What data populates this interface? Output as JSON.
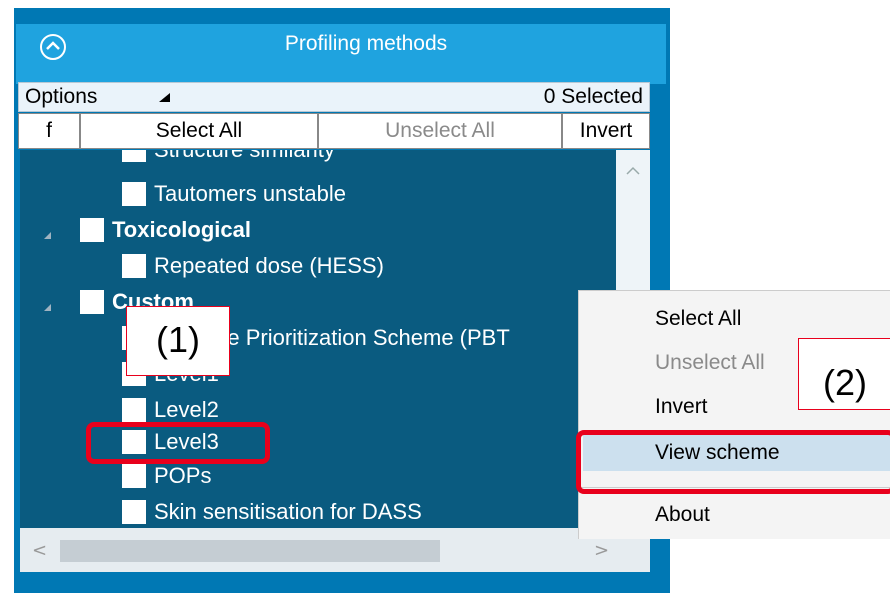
{
  "panel": {
    "title": "Profiling methods",
    "options_label": "Options",
    "selected_count": "0 Selected",
    "buttons": {
      "f": "f",
      "select_all": "Select All",
      "unselect_all": "Unselect All",
      "invert": "Invert"
    }
  },
  "tree": {
    "items": [
      {
        "label": "Structure similarity",
        "bold": false
      },
      {
        "label": "Tautomers unstable",
        "bold": false
      },
      {
        "label": "Toxicological",
        "bold": true
      },
      {
        "label": "Repeated dose (HESS)",
        "bold": false
      },
      {
        "label": "Custom",
        "bold": true
      },
      {
        "label": "Example Prioritization Scheme (PBT",
        "bold": false
      },
      {
        "label": "Level1",
        "bold": false
      },
      {
        "label": "Level2",
        "bold": false
      },
      {
        "label": "Level3",
        "bold": false
      },
      {
        "label": "POPs",
        "bold": false
      },
      {
        "label": "Skin sensitisation for DASS",
        "bold": false
      }
    ]
  },
  "context_menu": {
    "items": [
      {
        "label": "Select All",
        "enabled": true
      },
      {
        "label": "Unselect All",
        "enabled": false
      },
      {
        "label": "Invert",
        "enabled": true
      },
      {
        "label": "View scheme",
        "enabled": true,
        "highlighted": true
      },
      {
        "label": "About",
        "enabled": true
      }
    ]
  },
  "annotations": {
    "callout1": "(1)",
    "callout2": "(2)",
    "color": "#e8001c"
  },
  "colors": {
    "panel": "#0078b4",
    "header": "#1fa3df",
    "tree_bg": "#0a5b80",
    "menu_highlight": "#cce0ee"
  }
}
